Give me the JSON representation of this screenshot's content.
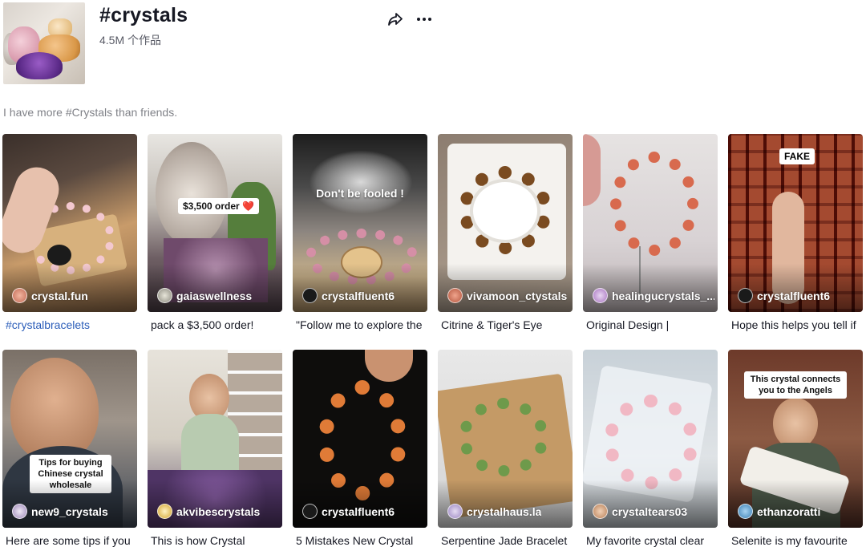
{
  "header": {
    "title": "#crystals",
    "count": "4.5M 个作品",
    "description": "I have more #Crystals than friends."
  },
  "icons": {
    "share": "share-arrow-icon",
    "more": "more-horizontal-icon"
  },
  "videos": [
    {
      "author": "crystal.fun",
      "caption": "#crystalbracelets",
      "caption_is_link": true,
      "overlay": ""
    },
    {
      "author": "gaiaswellness",
      "caption": "pack a $3,500 order!",
      "caption_is_link": false,
      "overlay": "$3,500 order ❤️"
    },
    {
      "author": "crystalfluent6",
      "caption": "\"Follow me to explore the",
      "caption_is_link": false,
      "overlay": "Don't be fooled !"
    },
    {
      "author": "vivamoon_ctystals",
      "caption": "Citrine & Tiger's Eye",
      "caption_is_link": false,
      "overlay": ""
    },
    {
      "author": "healingucrystals_...",
      "caption": "Original Design |",
      "caption_is_link": false,
      "overlay": ""
    },
    {
      "author": "crystalfluent6",
      "caption": "Hope this helps you tell if",
      "caption_is_link": false,
      "overlay": "FAKE"
    },
    {
      "author": "new9_crystals",
      "caption": "Here are some tips if you",
      "caption_is_link": false,
      "overlay": "Tips for buying Chinese crystal wholesale"
    },
    {
      "author": "akvibescrystals",
      "caption": "This is how Crystal",
      "caption_is_link": false,
      "overlay": ""
    },
    {
      "author": "crystalfluent6",
      "caption": "5 Mistakes New Crystal",
      "caption_is_link": false,
      "overlay": ""
    },
    {
      "author": "crystalhaus.la",
      "caption": "Serpentine Jade Bracelet",
      "caption_is_link": false,
      "overlay": ""
    },
    {
      "author": "crystaltears03",
      "caption": "My favorite crystal clear",
      "caption_is_link": false,
      "overlay": ""
    },
    {
      "author": "ethanzoratti",
      "caption": "Selenite is my favourite",
      "caption_is_link": false,
      "overlay": "This crystal connects you to the Angels"
    }
  ]
}
